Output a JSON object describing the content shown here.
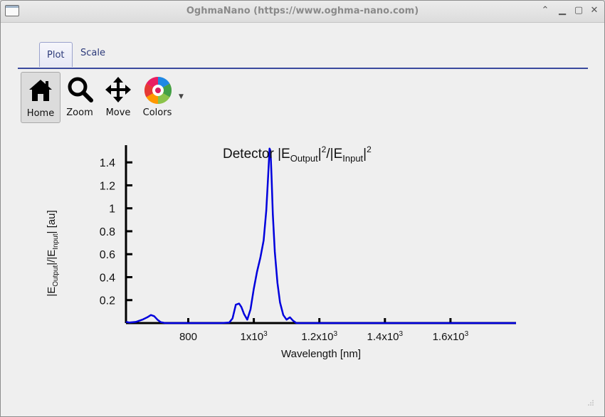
{
  "window": {
    "title": "OghmaNano (https://www.oghma-nano.com)"
  },
  "tabs": [
    {
      "label": "Plot"
    },
    {
      "label": "Scale"
    }
  ],
  "toolbar": {
    "home_label": "Home",
    "zoom_label": "Zoom",
    "move_label": "Move",
    "colors_label": "Colors"
  },
  "chart_data": {
    "type": "line",
    "title_main": "Detector |E",
    "title_sub1": "Output",
    "title_sup1": "2",
    "title_mid": "/|E",
    "title_sub2": "Input",
    "title_sup2": "2",
    "ylabel_a": "|E",
    "ylabel_sub1": "Output",
    "ylabel_b": "|/|E",
    "ylabel_sub2": "Input",
    "ylabel_c": "| [au]",
    "xlabel": "Wavelength [nm]",
    "xlim": [
      610,
      1800
    ],
    "ylim": [
      0,
      1.55
    ],
    "xticks": [
      {
        "value": 800,
        "label": "800"
      },
      {
        "value": 1000,
        "label": "1x10",
        "exp": "3"
      },
      {
        "value": 1200,
        "label": "1.2x10",
        "exp": "3"
      },
      {
        "value": 1400,
        "label": "1.4x10",
        "exp": "3"
      },
      {
        "value": 1600,
        "label": "1.6x10",
        "exp": "3"
      }
    ],
    "yticks": [
      {
        "value": 0.2,
        "label": "0.2"
      },
      {
        "value": 0.4,
        "label": "0.4"
      },
      {
        "value": 0.6,
        "label": "0.6"
      },
      {
        "value": 0.8,
        "label": "0.8"
      },
      {
        "value": 1.0,
        "label": "1"
      },
      {
        "value": 1.2,
        "label": "1.2"
      },
      {
        "value": 1.4,
        "label": "1.4"
      }
    ],
    "series": [
      {
        "color": "#0000dd",
        "x": [
          610,
          620,
          640,
          660,
          675,
          686,
          696,
          706,
          716,
          730,
          760,
          800,
          850,
          900,
          925,
          935,
          945,
          955,
          962,
          970,
          980,
          990,
          1000,
          1010,
          1020,
          1030,
          1038,
          1044,
          1048,
          1051,
          1054,
          1058,
          1064,
          1072,
          1080,
          1090,
          1100,
          1110,
          1120,
          1130,
          1160,
          1200,
          1300,
          1400,
          1500,
          1600,
          1700,
          1800
        ],
        "y": [
          0.01,
          0.005,
          0.01,
          0.03,
          0.05,
          0.07,
          0.06,
          0.03,
          0.008,
          0.0,
          0.0,
          0.0,
          0.0,
          0.0,
          0.005,
          0.04,
          0.16,
          0.17,
          0.14,
          0.08,
          0.03,
          0.12,
          0.3,
          0.45,
          0.57,
          0.72,
          0.98,
          1.3,
          1.52,
          1.5,
          1.28,
          0.95,
          0.62,
          0.35,
          0.18,
          0.07,
          0.03,
          0.05,
          0.02,
          0.0,
          0.0,
          0.0,
          0.0,
          0.0,
          0.0,
          0.0,
          0.0,
          0.0
        ]
      }
    ],
    "grid": false
  }
}
